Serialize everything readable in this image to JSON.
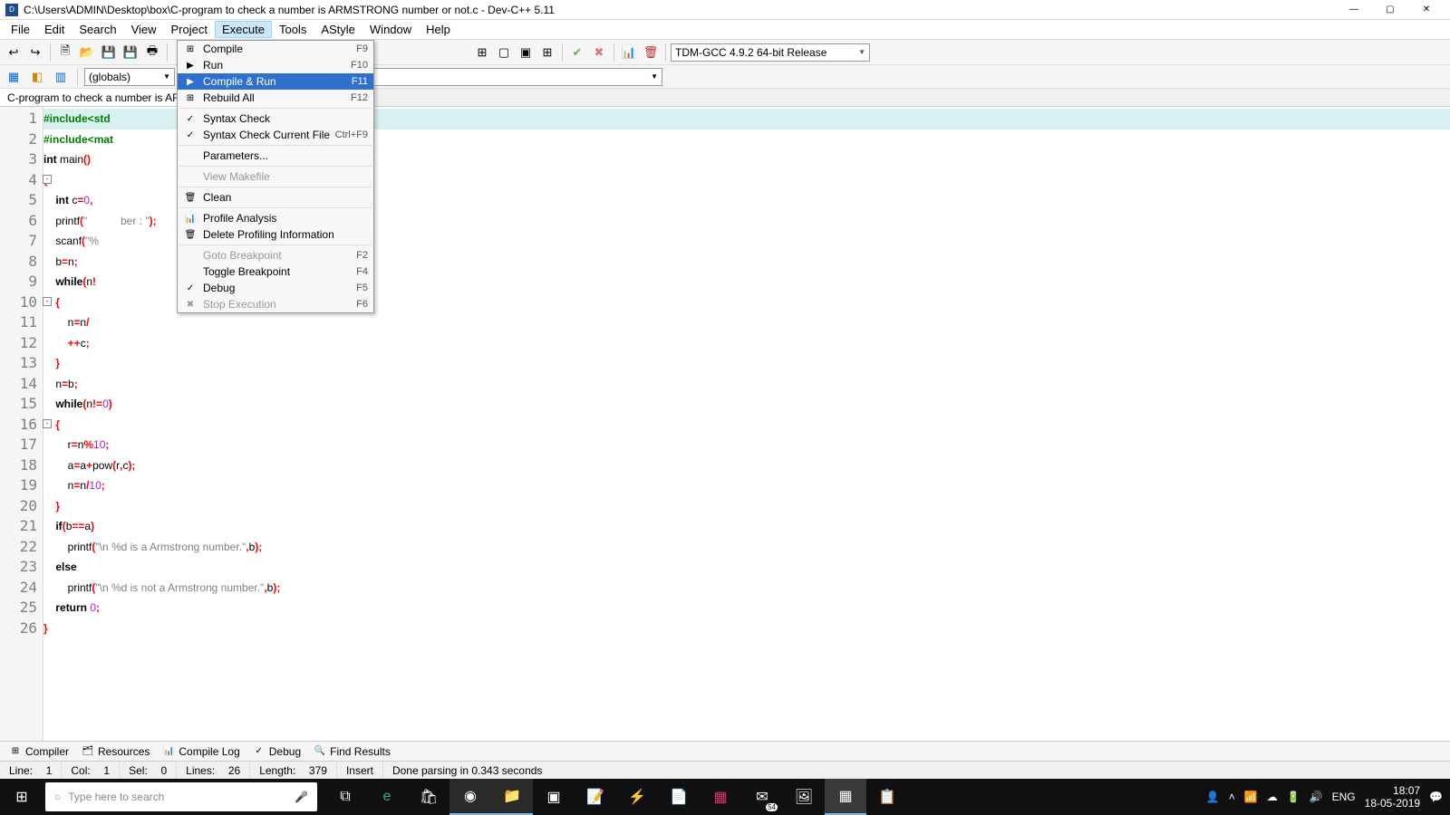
{
  "titlebar": {
    "path": "C:\\Users\\ADMIN\\Desktop\\box\\C-program to check a number is ARMSTRONG number or not.c - Dev-C++ 5.11"
  },
  "menubar": [
    "File",
    "Edit",
    "Search",
    "View",
    "Project",
    "Execute",
    "Tools",
    "AStyle",
    "Window",
    "Help"
  ],
  "toolbar": {
    "compiler_combo": "TDM-GCC 4.9.2 64-bit Release"
  },
  "toolbar2": {
    "globals": "(globals)"
  },
  "file_tab": "C-program to check a number is ARM",
  "dropdown": [
    {
      "icon": "grid",
      "label": "Compile",
      "shortcut": "F9",
      "kind": "item"
    },
    {
      "icon": "play",
      "label": "Run",
      "shortcut": "F10",
      "kind": "item"
    },
    {
      "icon": "playgrid",
      "label": "Compile & Run",
      "shortcut": "F11",
      "kind": "item",
      "selected": true
    },
    {
      "icon": "grid",
      "label": "Rebuild All",
      "shortcut": "F12",
      "kind": "item"
    },
    {
      "kind": "sep"
    },
    {
      "icon": "check",
      "label": "Syntax Check",
      "shortcut": "",
      "kind": "item"
    },
    {
      "icon": "check",
      "label": "Syntax Check Current File",
      "shortcut": "Ctrl+F9",
      "kind": "item"
    },
    {
      "kind": "sep"
    },
    {
      "icon": "",
      "label": "Parameters...",
      "shortcut": "",
      "kind": "item"
    },
    {
      "kind": "sep"
    },
    {
      "icon": "",
      "label": "View Makefile",
      "shortcut": "",
      "kind": "item",
      "disabled": true
    },
    {
      "kind": "sep"
    },
    {
      "icon": "trash",
      "label": "Clean",
      "shortcut": "",
      "kind": "item"
    },
    {
      "kind": "sep"
    },
    {
      "icon": "chart",
      "label": "Profile Analysis",
      "shortcut": "",
      "kind": "item"
    },
    {
      "icon": "del",
      "label": "Delete Profiling Information",
      "shortcut": "",
      "kind": "item"
    },
    {
      "kind": "sep"
    },
    {
      "icon": "",
      "label": "Goto Breakpoint",
      "shortcut": "F2",
      "kind": "item",
      "disabled": true
    },
    {
      "icon": "",
      "label": "Toggle Breakpoint",
      "shortcut": "F4",
      "kind": "item"
    },
    {
      "icon": "checkp",
      "label": "Debug",
      "shortcut": "F5",
      "kind": "item"
    },
    {
      "icon": "stop",
      "label": "Stop Execution",
      "shortcut": "F6",
      "kind": "item",
      "disabled": true
    }
  ],
  "code_lines": [
    {
      "n": 1,
      "hl": true,
      "html": "<span class='prep'>#include&lt;std</span>"
    },
    {
      "n": 2,
      "html": "<span class='prep'>#include&lt;mat</span>"
    },
    {
      "n": 3,
      "html": "<span class='kw'>int</span> <span class='fn'>main</span><span class='op'>()</span>"
    },
    {
      "n": 4,
      "fold": true,
      "html": "<span class='op'>{</span>"
    },
    {
      "n": 5,
      "html": "    <span class='kw'>int</span> c<span class='op'>=</span><span class='num'>0</span><span class='op'>,</span>"
    },
    {
      "n": 6,
      "html": "    <span class='fn'>printf</span><span class='op'>(</span><span class='str'>\"</span>           <span class='str'>ber : \"</span><span class='op'>);</span>"
    },
    {
      "n": 7,
      "html": "    <span class='fn'>scanf</span><span class='op'>(</span><span class='str'>\"%</span>"
    },
    {
      "n": 8,
      "html": "    b<span class='op'>=</span>n<span class='op'>;</span>"
    },
    {
      "n": 9,
      "html": "    <span class='kw'>while</span><span class='op'>(</span>n<span class='op'>!</span>"
    },
    {
      "n": 10,
      "fold": true,
      "html": "    <span class='op'>{</span>"
    },
    {
      "n": 11,
      "html": "        n<span class='op'>=</span>n<span class='op'>/</span>"
    },
    {
      "n": 12,
      "html": "        <span class='op'>++</span>c<span class='op'>;</span>"
    },
    {
      "n": 13,
      "html": "    <span class='op'>}</span>"
    },
    {
      "n": 14,
      "html": "    n<span class='op'>=</span>b<span class='op'>;</span>"
    },
    {
      "n": 15,
      "html": "    <span class='kw'>while</span><span class='op'>(</span>n<span class='op'>!=</span><span class='num'>0</span><span class='op'>)</span>"
    },
    {
      "n": 16,
      "fold": true,
      "html": "    <span class='op'>{</span>"
    },
    {
      "n": 17,
      "html": "        r<span class='op'>=</span>n<span class='op'>%</span><span class='num'>10</span><span class='op'>;</span>"
    },
    {
      "n": 18,
      "html": "        a<span class='op'>=</span>a<span class='op'>+</span><span class='fn'>pow</span><span class='op'>(</span>r<span class='op'>,</span>c<span class='op'>);</span>"
    },
    {
      "n": 19,
      "html": "        n<span class='op'>=</span>n<span class='op'>/</span><span class='num'>10</span><span class='op'>;</span>"
    },
    {
      "n": 20,
      "html": "    <span class='op'>}</span>"
    },
    {
      "n": 21,
      "html": "    <span class='kw'>if</span><span class='op'>(</span>b<span class='op'>==</span>a<span class='op'>)</span>"
    },
    {
      "n": 22,
      "html": "        <span class='fn'>printf</span><span class='op'>(</span><span class='str'>\"\\n %d is a Armstrong number.\"</span><span class='op'>,</span>b<span class='op'>);</span>"
    },
    {
      "n": 23,
      "html": "    <span class='kw'>else</span>"
    },
    {
      "n": 24,
      "html": "        <span class='fn'>printf</span><span class='op'>(</span><span class='str'>\"\\n %d is not a Armstrong number.\"</span><span class='op'>,</span>b<span class='op'>);</span>"
    },
    {
      "n": 25,
      "html": "    <span class='kw'>return</span> <span class='num'>0</span><span class='op'>;</span>"
    },
    {
      "n": 26,
      "html": "<span class='op'>}</span>"
    }
  ],
  "bottom_tabs": [
    {
      "icon": "⊞",
      "label": "Compiler"
    },
    {
      "icon": "🗂",
      "label": "Resources"
    },
    {
      "icon": "📊",
      "label": "Compile Log"
    },
    {
      "icon": "✓",
      "label": "Debug"
    },
    {
      "icon": "🔍",
      "label": "Find Results"
    }
  ],
  "statusbar": {
    "line_label": "Line:",
    "line": "1",
    "col_label": "Col:",
    "col": "1",
    "sel_label": "Sel:",
    "sel": "0",
    "lines_label": "Lines:",
    "lines": "26",
    "length_label": "Length:",
    "length": "379",
    "insert": "Insert",
    "parse": "Done parsing in 0.343 seconds"
  },
  "taskbar": {
    "search_placeholder": "Type here to search",
    "lang": "ENG",
    "time": "18:07",
    "date": "18-05-2019",
    "mail_count": "54"
  }
}
